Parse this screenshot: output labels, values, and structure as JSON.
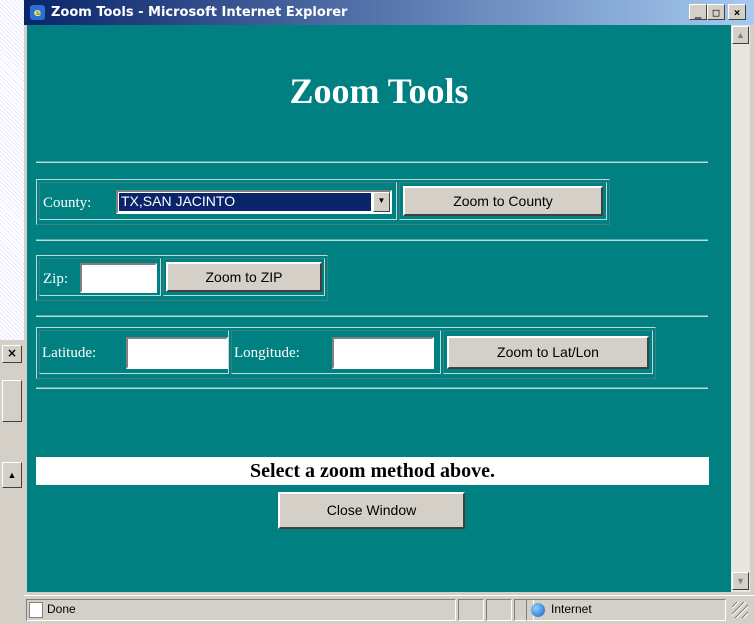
{
  "window": {
    "title": "Zoom Tools - Microsoft Internet Explorer",
    "min_glyph": "_",
    "max_glyph": "□",
    "close_glyph": "×"
  },
  "page": {
    "heading": "Zoom Tools",
    "county": {
      "label": "County:",
      "selected": "TX,SAN JACINTO",
      "button": "Zoom to County"
    },
    "zip": {
      "label": "Zip:",
      "value": "",
      "button": "Zoom to ZIP"
    },
    "latlon": {
      "lat_label": "Latitude:",
      "lon_label": "Longitude:",
      "lat_value": "",
      "lon_value": "",
      "button": "Zoom to Lat/Lon"
    },
    "message": "Select a zoom method above.",
    "close_button": "Close Window"
  },
  "statusbar": {
    "status": "Done",
    "zone": "Internet"
  },
  "colors": {
    "page_background": "#008080",
    "title_gradient_start": "#0a246a",
    "selection": "#0a246a"
  }
}
